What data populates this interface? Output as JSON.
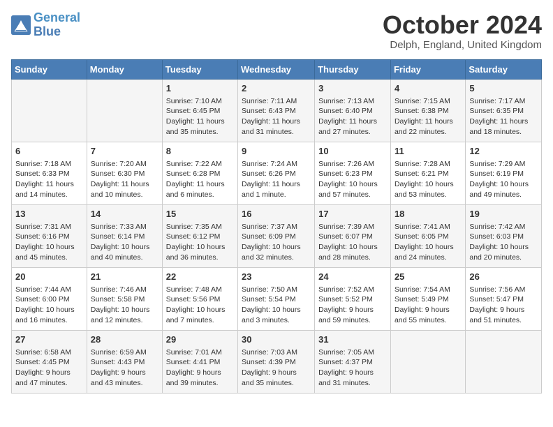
{
  "logo": {
    "line1": "General",
    "line2": "Blue"
  },
  "title": "October 2024",
  "location": "Delph, England, United Kingdom",
  "days_header": [
    "Sunday",
    "Monday",
    "Tuesday",
    "Wednesday",
    "Thursday",
    "Friday",
    "Saturday"
  ],
  "weeks": [
    [
      {
        "day": "",
        "info": ""
      },
      {
        "day": "",
        "info": ""
      },
      {
        "day": "1",
        "info": "Sunrise: 7:10 AM\nSunset: 6:45 PM\nDaylight: 11 hours and 35 minutes."
      },
      {
        "day": "2",
        "info": "Sunrise: 7:11 AM\nSunset: 6:43 PM\nDaylight: 11 hours and 31 minutes."
      },
      {
        "day": "3",
        "info": "Sunrise: 7:13 AM\nSunset: 6:40 PM\nDaylight: 11 hours and 27 minutes."
      },
      {
        "day": "4",
        "info": "Sunrise: 7:15 AM\nSunset: 6:38 PM\nDaylight: 11 hours and 22 minutes."
      },
      {
        "day": "5",
        "info": "Sunrise: 7:17 AM\nSunset: 6:35 PM\nDaylight: 11 hours and 18 minutes."
      }
    ],
    [
      {
        "day": "6",
        "info": "Sunrise: 7:18 AM\nSunset: 6:33 PM\nDaylight: 11 hours and 14 minutes."
      },
      {
        "day": "7",
        "info": "Sunrise: 7:20 AM\nSunset: 6:30 PM\nDaylight: 11 hours and 10 minutes."
      },
      {
        "day": "8",
        "info": "Sunrise: 7:22 AM\nSunset: 6:28 PM\nDaylight: 11 hours and 6 minutes."
      },
      {
        "day": "9",
        "info": "Sunrise: 7:24 AM\nSunset: 6:26 PM\nDaylight: 11 hours and 1 minute."
      },
      {
        "day": "10",
        "info": "Sunrise: 7:26 AM\nSunset: 6:23 PM\nDaylight: 10 hours and 57 minutes."
      },
      {
        "day": "11",
        "info": "Sunrise: 7:28 AM\nSunset: 6:21 PM\nDaylight: 10 hours and 53 minutes."
      },
      {
        "day": "12",
        "info": "Sunrise: 7:29 AM\nSunset: 6:19 PM\nDaylight: 10 hours and 49 minutes."
      }
    ],
    [
      {
        "day": "13",
        "info": "Sunrise: 7:31 AM\nSunset: 6:16 PM\nDaylight: 10 hours and 45 minutes."
      },
      {
        "day": "14",
        "info": "Sunrise: 7:33 AM\nSunset: 6:14 PM\nDaylight: 10 hours and 40 minutes."
      },
      {
        "day": "15",
        "info": "Sunrise: 7:35 AM\nSunset: 6:12 PM\nDaylight: 10 hours and 36 minutes."
      },
      {
        "day": "16",
        "info": "Sunrise: 7:37 AM\nSunset: 6:09 PM\nDaylight: 10 hours and 32 minutes."
      },
      {
        "day": "17",
        "info": "Sunrise: 7:39 AM\nSunset: 6:07 PM\nDaylight: 10 hours and 28 minutes."
      },
      {
        "day": "18",
        "info": "Sunrise: 7:41 AM\nSunset: 6:05 PM\nDaylight: 10 hours and 24 minutes."
      },
      {
        "day": "19",
        "info": "Sunrise: 7:42 AM\nSunset: 6:03 PM\nDaylight: 10 hours and 20 minutes."
      }
    ],
    [
      {
        "day": "20",
        "info": "Sunrise: 7:44 AM\nSunset: 6:00 PM\nDaylight: 10 hours and 16 minutes."
      },
      {
        "day": "21",
        "info": "Sunrise: 7:46 AM\nSunset: 5:58 PM\nDaylight: 10 hours and 12 minutes."
      },
      {
        "day": "22",
        "info": "Sunrise: 7:48 AM\nSunset: 5:56 PM\nDaylight: 10 hours and 7 minutes."
      },
      {
        "day": "23",
        "info": "Sunrise: 7:50 AM\nSunset: 5:54 PM\nDaylight: 10 hours and 3 minutes."
      },
      {
        "day": "24",
        "info": "Sunrise: 7:52 AM\nSunset: 5:52 PM\nDaylight: 9 hours and 59 minutes."
      },
      {
        "day": "25",
        "info": "Sunrise: 7:54 AM\nSunset: 5:49 PM\nDaylight: 9 hours and 55 minutes."
      },
      {
        "day": "26",
        "info": "Sunrise: 7:56 AM\nSunset: 5:47 PM\nDaylight: 9 hours and 51 minutes."
      }
    ],
    [
      {
        "day": "27",
        "info": "Sunrise: 6:58 AM\nSunset: 4:45 PM\nDaylight: 9 hours and 47 minutes."
      },
      {
        "day": "28",
        "info": "Sunrise: 6:59 AM\nSunset: 4:43 PM\nDaylight: 9 hours and 43 minutes."
      },
      {
        "day": "29",
        "info": "Sunrise: 7:01 AM\nSunset: 4:41 PM\nDaylight: 9 hours and 39 minutes."
      },
      {
        "day": "30",
        "info": "Sunrise: 7:03 AM\nSunset: 4:39 PM\nDaylight: 9 hours and 35 minutes."
      },
      {
        "day": "31",
        "info": "Sunrise: 7:05 AM\nSunset: 4:37 PM\nDaylight: 9 hours and 31 minutes."
      },
      {
        "day": "",
        "info": ""
      },
      {
        "day": "",
        "info": ""
      }
    ]
  ]
}
